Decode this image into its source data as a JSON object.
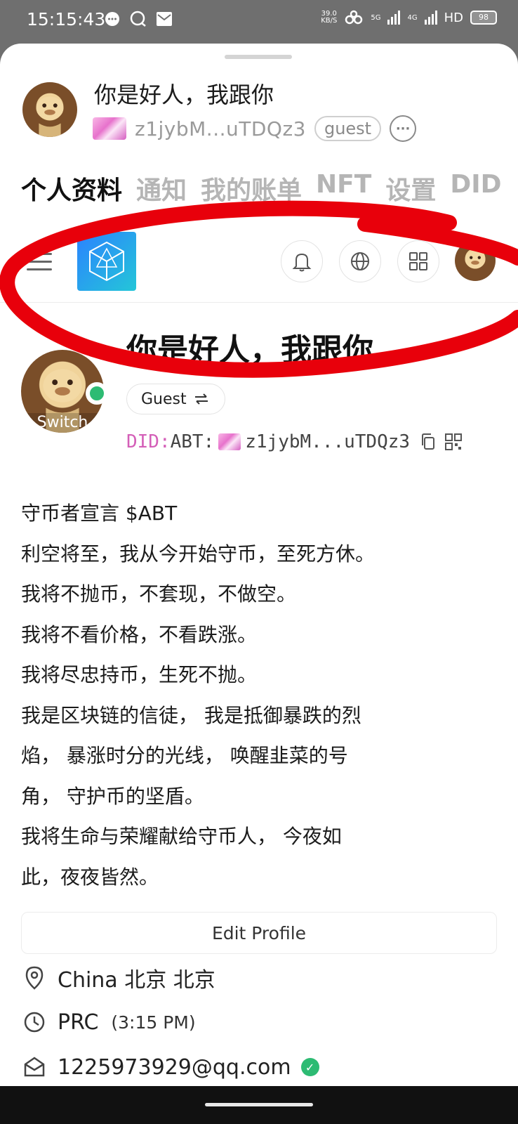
{
  "status_bar": {
    "time": "15:15:43",
    "net_speed_value": "39.0",
    "net_speed_unit": "KB/S",
    "signal_1": "5G",
    "signal_2": "4G",
    "hd": "HD",
    "battery": "98"
  },
  "sheet_header": {
    "name": "你是好人，我跟你",
    "did_short": "z1jybM...uTDQz3",
    "role_badge": "guest"
  },
  "tabs": [
    {
      "label": "个人资料",
      "active": true
    },
    {
      "label": "通知",
      "active": false
    },
    {
      "label": "我的账单",
      "active": false
    },
    {
      "label": "NFT",
      "active": false
    },
    {
      "label": "设置",
      "active": false
    },
    {
      "label": "DID",
      "active": false
    }
  ],
  "profile": {
    "name": "你是好人，我跟你",
    "avatar_label": "Switch",
    "role_switch": "Guest",
    "did_prefix": "DID:",
    "did_chain": "ABT:",
    "did_short": "z1jybM...uTDQz3",
    "bio": [
      "守币者宣言 $ABT",
      "利空将至，我从今开始守币，至死方休。",
      "我将不抛币，不套现，不做空。",
      "我将不看价格，不看跌涨。",
      "我将尽忠持币，生死不抛。",
      "我是区块链的信徒， 我是抵御暴跌的烈",
      "焰， 暴涨时分的光线， 唤醒韭菜的号",
      "角， 守护币的坚盾。",
      "我将生命与荣耀献给守币人， 今夜如",
      "此，夜夜皆然。"
    ],
    "edit_button": "Edit Profile",
    "location": "China 北京 北京",
    "timezone": "PRC",
    "local_time": "(3:15 PM)",
    "email": "1225973929@qq.com"
  },
  "colors": {
    "annotation": "#e8000b",
    "online": "#2dbb73",
    "did_prefix": "#d45fb8",
    "logo_start": "#2b82ff",
    "logo_end": "#24c6d8"
  },
  "icons": [
    "bell-icon",
    "globe-icon",
    "apps-grid-icon",
    "menu-icon",
    "copy-icon",
    "qr-code-icon",
    "location-pin-icon",
    "clock-icon",
    "mail-icon",
    "verified-icon"
  ]
}
